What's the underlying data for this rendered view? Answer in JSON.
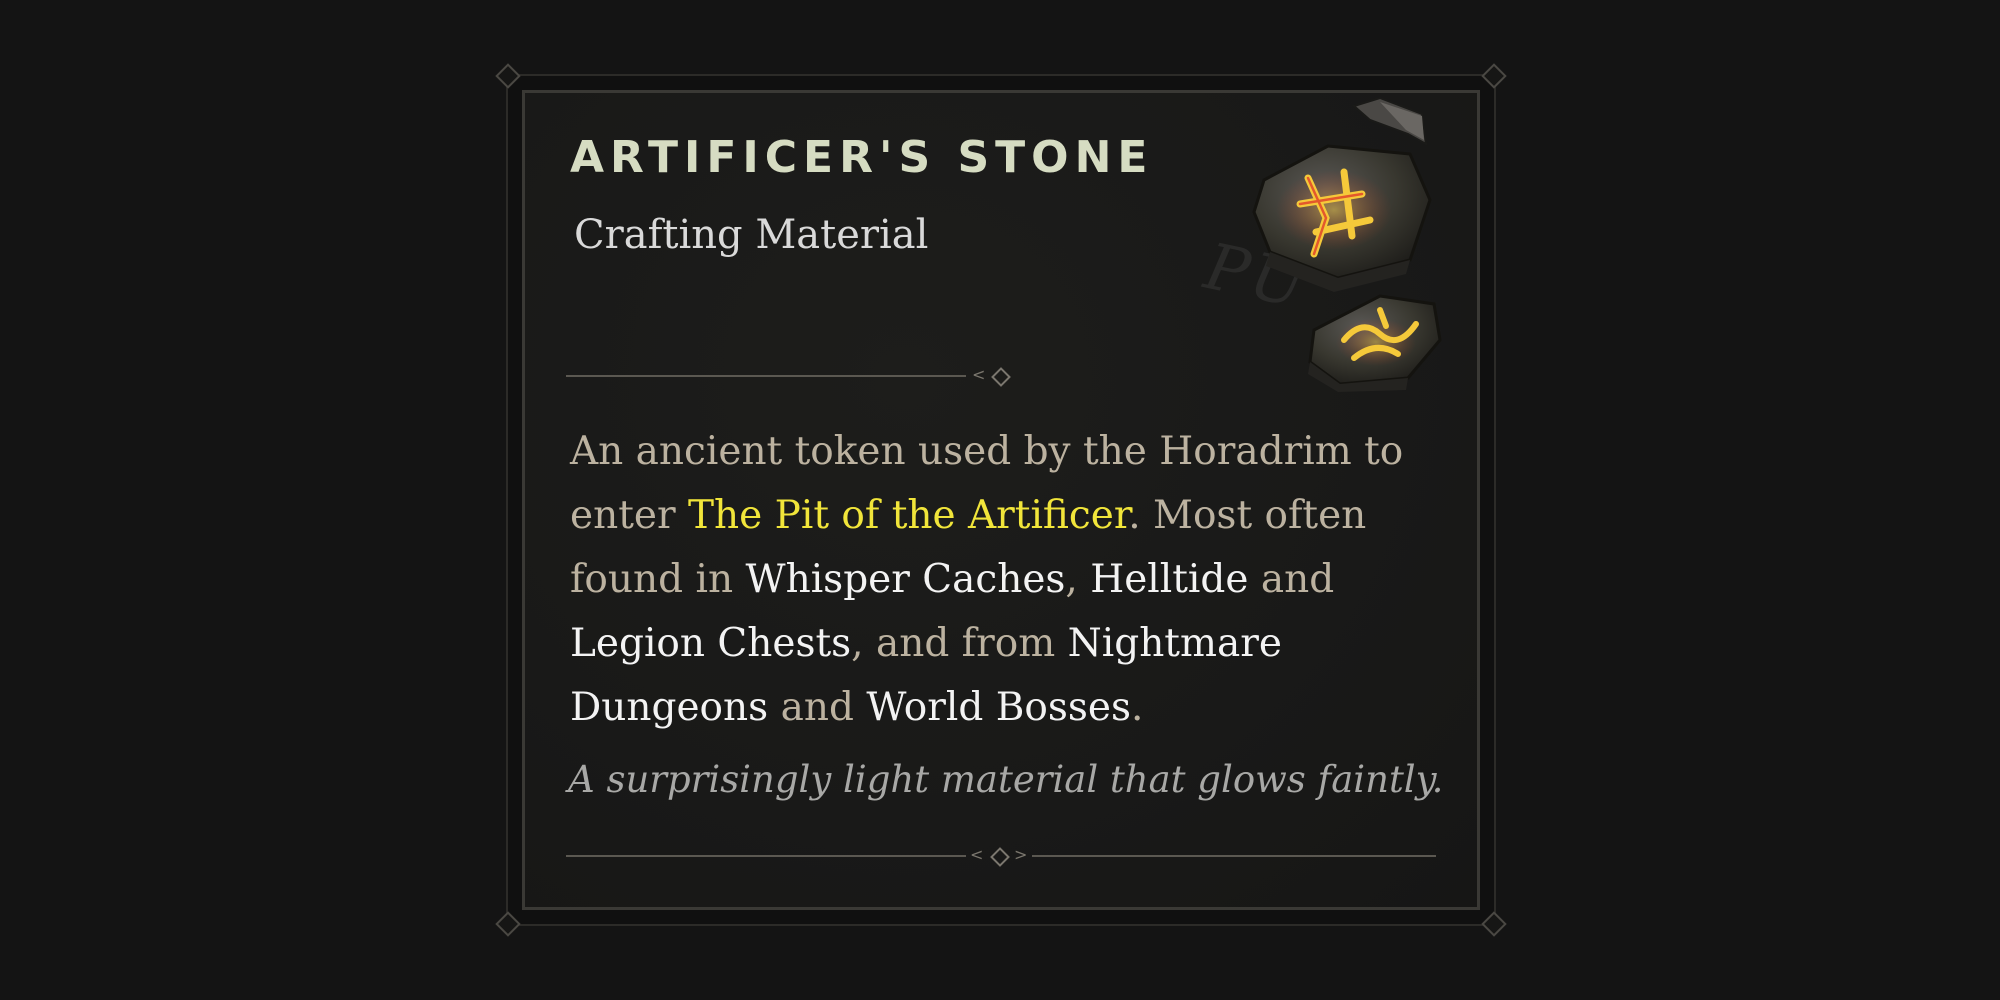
{
  "item": {
    "name": "ARTIFICER'S STONE",
    "type": "Crafting Material",
    "icon": "artificers-stone-rune-icon",
    "description": [
      {
        "text": "An ancient token used by the Horadrim to enter ",
        "style": "normal"
      },
      {
        "text": "The Pit of the Artificer",
        "style": "yellow"
      },
      {
        "text": ". Most often found in ",
        "style": "normal"
      },
      {
        "text": "Whisper Caches",
        "style": "white"
      },
      {
        "text": ", ",
        "style": "normal"
      },
      {
        "text": "Helltide",
        "style": "white"
      },
      {
        "text": " and ",
        "style": "normal"
      },
      {
        "text": "Legion Chests",
        "style": "white"
      },
      {
        "text": ", and from ",
        "style": "normal"
      },
      {
        "text": "Nightmare Dungeons",
        "style": "white"
      },
      {
        "text": " and ",
        "style": "normal"
      },
      {
        "text": "World Bosses",
        "style": "white"
      },
      {
        "text": ".",
        "style": "normal"
      }
    ],
    "flavor_text": "A surprisingly light material that glows faintly."
  },
  "watermark": "PU",
  "colors": {
    "title": "#d6dcc2",
    "highlight_yellow": "#f1e53a",
    "highlight_white": "#f3f3f3",
    "body_text": "#bcb2a0",
    "flavor_text": "#a8a8a6",
    "background": "#141414",
    "rune_glow": "#f0a020"
  }
}
